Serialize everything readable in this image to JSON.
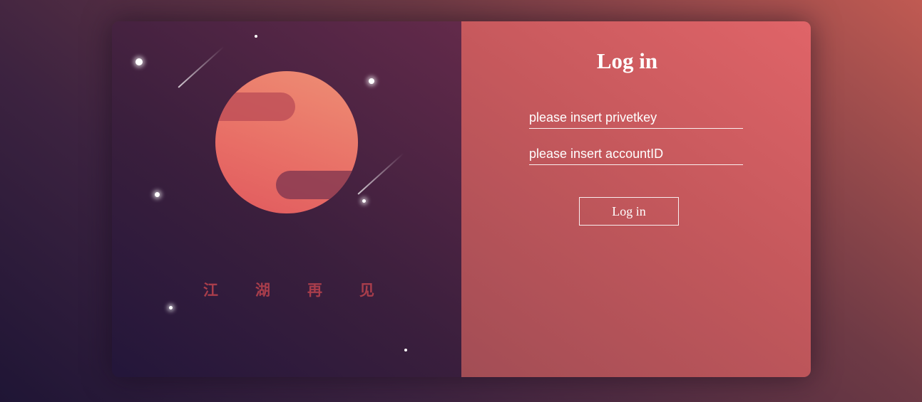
{
  "left_panel": {
    "slogan": [
      "江",
      "湖",
      "再",
      "见"
    ]
  },
  "login": {
    "title": "Log in",
    "privatekey_placeholder": "please insert privetkey",
    "accountid_placeholder": "please insert accountID",
    "submit_label": "Log in"
  },
  "colors": {
    "planet": "#e8725f",
    "slogan": "#a83d4b",
    "right_panel": "#c8585c",
    "left_panel": "#3b1f3d"
  }
}
